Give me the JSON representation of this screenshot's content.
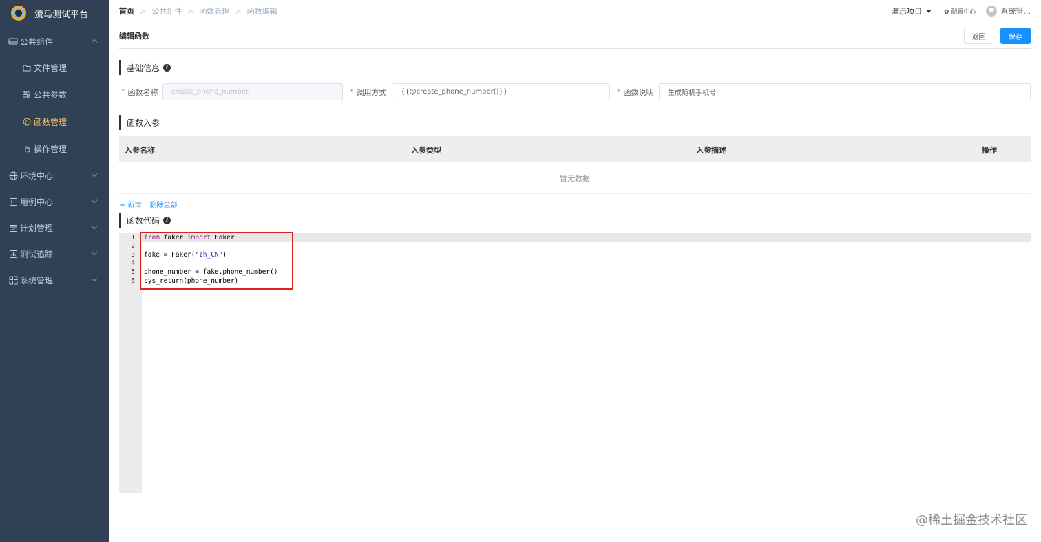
{
  "app": {
    "title": "流马测试平台"
  },
  "sidebar": {
    "items": [
      {
        "label": "公共组件",
        "icon": "component-icon",
        "expanded": true
      },
      {
        "label": "文件管理",
        "icon": "folder-icon",
        "sub": true
      },
      {
        "label": "公共参数",
        "icon": "params-icon",
        "sub": true
      },
      {
        "label": "函数管理",
        "icon": "function-icon",
        "sub": true,
        "active": true
      },
      {
        "label": "操作管理",
        "icon": "hand-icon",
        "sub": true
      },
      {
        "label": "环境中心",
        "icon": "globe-icon"
      },
      {
        "label": "用例中心",
        "icon": "case-icon"
      },
      {
        "label": "计划管理",
        "icon": "calendar-icon"
      },
      {
        "label": "测试追踪",
        "icon": "chart-icon"
      },
      {
        "label": "系统管理",
        "icon": "grid-icon"
      }
    ],
    "colors": {
      "background": "#304156",
      "active": "#f4c06a"
    }
  },
  "breadcrumb": [
    "首页",
    "公共组件",
    "函数管理",
    "函数编辑"
  ],
  "topbar": {
    "project": "演示项目",
    "config": "配置中心",
    "user": "系统管..."
  },
  "page": {
    "title": "编辑函数",
    "back_label": "返回",
    "save_label": "保存"
  },
  "basic_info": {
    "title": "基础信息",
    "name_label": "函数名称",
    "name_value": "create_phone_number",
    "call_label": "调用方式",
    "call_value": "{{@create_phone_number()}}",
    "desc_label": "函数说明",
    "desc_value": "生成随机手机号"
  },
  "params": {
    "title": "函数入参",
    "columns": [
      "入参名称",
      "入参类型",
      "入参描述",
      "操作"
    ],
    "empty_text": "暂无数据",
    "add_label": "+ 新增",
    "delete_all_label": "删除全部"
  },
  "code": {
    "title": "函数代码",
    "line_numbers": [
      "1",
      "2",
      "3",
      "4",
      "5",
      "6"
    ],
    "lines": [
      "from faker import Faker",
      "",
      "fake = Faker(\"zh_CN\")",
      "",
      "phone_number = fake.phone_number()",
      "sys_return(phone_number)"
    ]
  },
  "watermark": "@稀土掘金技术社区",
  "colors": {
    "primary": "#1890ff",
    "highlight_box": "#e0201f",
    "required": "#f56c6c"
  }
}
